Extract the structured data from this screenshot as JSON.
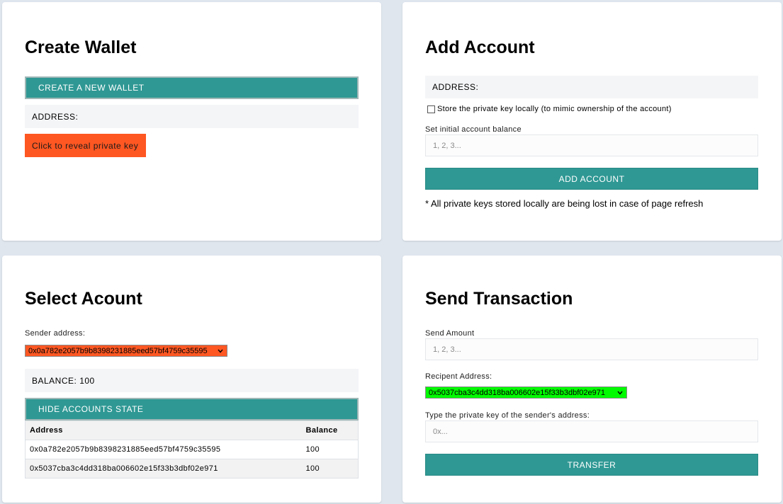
{
  "create_wallet": {
    "title": "Create Wallet",
    "create_button": "CREATE A NEW WALLET",
    "address_label": "ADDRESS:",
    "reveal_button": "Click to reveal private key"
  },
  "add_account": {
    "title": "Add Account",
    "address_label": "ADDRESS:",
    "store_checkbox_label": "Store the private key locally (to mimic ownership of the account)",
    "balance_label": "Set initial account balance",
    "balance_placeholder": "1, 2, 3...",
    "add_button": "ADD ACCOUNT",
    "note": "* All private keys stored locally are being lost in case of page refresh"
  },
  "select_account": {
    "title": "Select Acount",
    "sender_label": "Sender address:",
    "sender_value": "0x0a782e2057b9b8398231885eed57bf4759c35595",
    "balance_text": "BALANCE: 100",
    "hide_button": "HIDE ACCOUNTS STATE",
    "table": {
      "headers": [
        "Address",
        "Balance"
      ],
      "rows": [
        [
          "0x0a782e2057b9b8398231885eed57bf4759c35595",
          "100"
        ],
        [
          "0x5037cba3c4dd318ba006602e15f33b3dbf02e971",
          "100"
        ]
      ]
    }
  },
  "send_transaction": {
    "title": "Send Transaction",
    "amount_label": "Send Amount",
    "amount_placeholder": "1, 2, 3...",
    "recipient_label": "Recipent Address:",
    "recipient_value": "0x5037cba3c4dd318ba006602e15f33b3dbf02e971",
    "private_key_label": "Type the private key of the sender's address:",
    "private_key_placeholder": "0x...",
    "transfer_button": "TRANSFER"
  },
  "colors": {
    "page_background": "#dfe6ee",
    "accent_teal": "#2f9894",
    "reveal_orange": "#fe5722",
    "sender_select_orange": "#fe5722",
    "recipient_select_green": "#00fa00",
    "info_box_gray": "#f4f5f7"
  },
  "icons": {
    "select_chevron": "chevron-down-icon",
    "checkbox": "checkbox-unchecked"
  }
}
